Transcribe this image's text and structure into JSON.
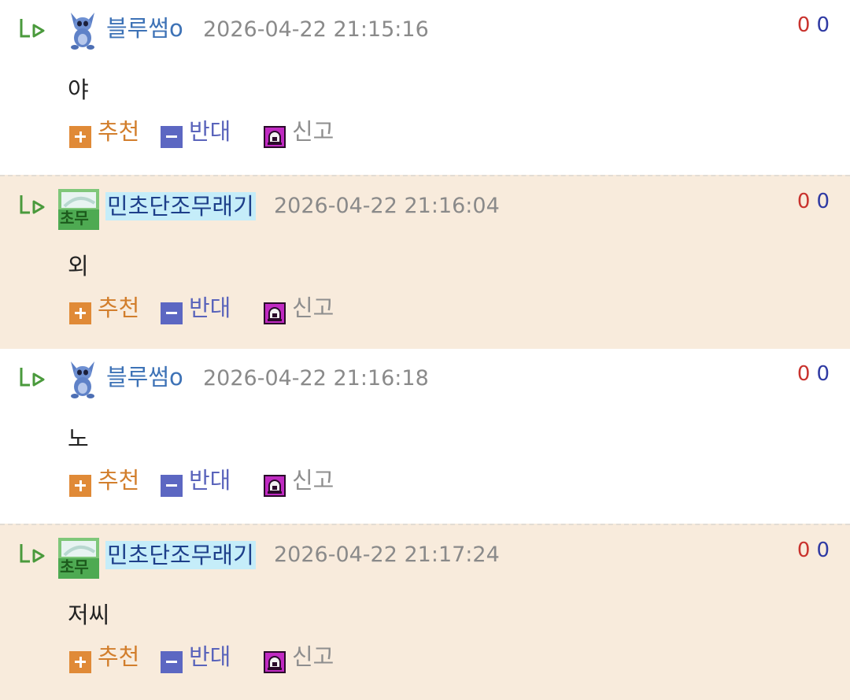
{
  "colors": {
    "alt_row_bg": "#f8ebdc",
    "nick_blue": "#3d72b6",
    "nick_highlight": "#c5edf9",
    "recommend_orange": "#e08a37",
    "oppose_blue": "#5c67c2",
    "report_magenta": "#c02ac2",
    "up_count_red": "#c9332e",
    "down_count_navy": "#2f3aa3"
  },
  "icons": {
    "reply": "reply-arrow-icon",
    "recommend": "plus-icon",
    "oppose": "minus-icon",
    "report": "siren-icon"
  },
  "labels": {
    "recommend": "추천",
    "oppose": "반대",
    "report": "신고"
  },
  "comments": [
    {
      "author": "블루썸o",
      "avatar": "stitch-avatar",
      "timestamp": "2026-04-22 21:15:16",
      "body": "야",
      "up": "0",
      "down": "0"
    },
    {
      "author": "민초단조무래기",
      "avatar": "green-badge-avatar",
      "timestamp": "2026-04-22 21:16:04",
      "body": "외",
      "up": "0",
      "down": "0"
    },
    {
      "author": "블루썸o",
      "avatar": "stitch-avatar",
      "timestamp": "2026-04-22 21:16:18",
      "body": "노",
      "up": "0",
      "down": "0"
    },
    {
      "author": "민초단조무래기",
      "avatar": "green-badge-avatar",
      "timestamp": "2026-04-22 21:17:24",
      "body": "저씨",
      "up": "0",
      "down": "0"
    }
  ]
}
